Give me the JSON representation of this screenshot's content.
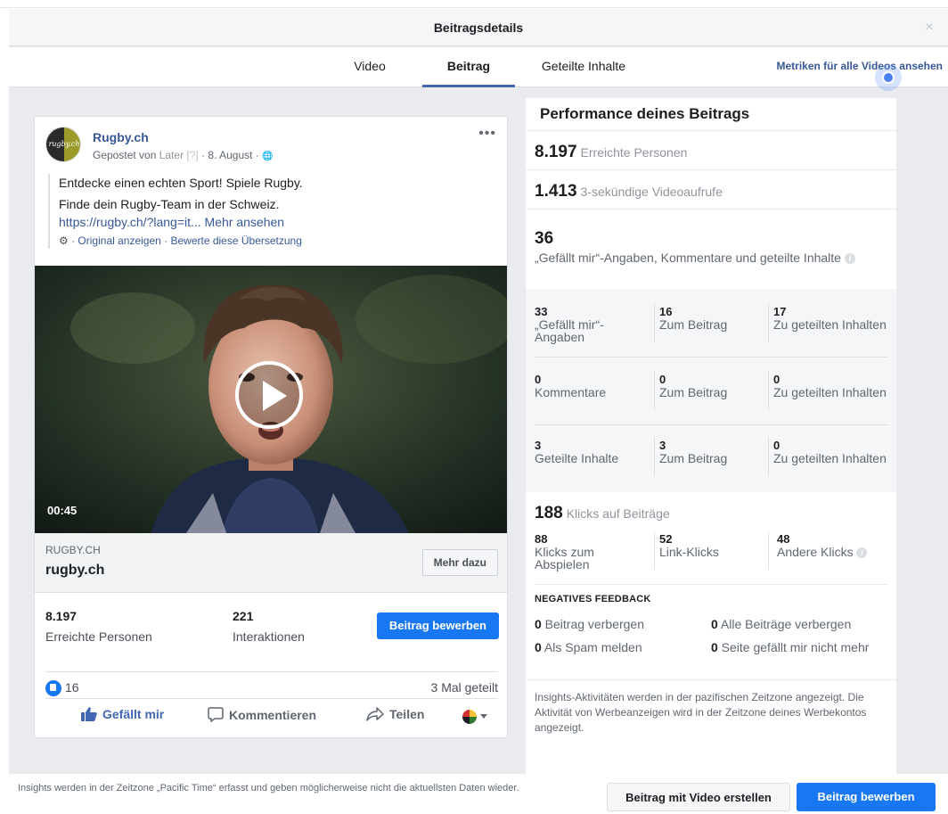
{
  "dialog": {
    "title": "Beitragsdetails",
    "close_glyph": "×"
  },
  "tabs": [
    {
      "label": "Video",
      "active": false
    },
    {
      "label": "Beitrag",
      "active": true
    },
    {
      "label": "Geteilte Inhalte",
      "active": false
    }
  ],
  "metrics_link": "Metriken für alle Videos ansehen",
  "post": {
    "page_name": "Rugby.ch",
    "avatar_text": "rugby.ch",
    "meta_prefix": "Gepostet von ",
    "meta_tool": "Later",
    "meta_q": " [?]",
    "meta_suffix": " · 8. August · ",
    "globe_glyph": "🌐",
    "more_glyph": "•••",
    "text_line1": "Entdecke einen echten Sport! Spiele Rugby.",
    "text_line2": "Finde dein Rugby-Team in der Schweiz.",
    "text_link": "https://rugby.ch/?lang=it...",
    "more_link": " Mehr ansehen",
    "translation_gear": "⚙",
    "translation_text": " · Original anzeigen · Bewerte diese Übersetzung",
    "video_duration": "00:45",
    "link_domain": "RUGBY.CH",
    "link_title": "rugby.ch",
    "link_button": "Mehr dazu",
    "reach_value": "8.197",
    "reach_label": "Erreichte Personen",
    "interactions_value": "221",
    "interactions_label": "Interaktionen",
    "boost_button": "Beitrag bewerben",
    "reactions_count": "16",
    "shares_text": "3 Mal geteilt",
    "action_like": "Gefällt mir",
    "action_comment": "Kommentieren",
    "action_share": "Teilen"
  },
  "performance": {
    "title": "Performance deines Beitrags",
    "reach_num": "8.197",
    "reach_label": "Erreichte Personen",
    "views_num": "1.413",
    "views_label": "3-sekündige Videoaufrufe",
    "interactions_num": "36",
    "interactions_label": "„Gefällt mir“-Angaben, Kommentare und geteilte Inhalte",
    "grid": [
      [
        {
          "v": "33",
          "l": "„Gefällt mir“-Angaben"
        },
        {
          "v": "16",
          "l": "Zum Beitrag"
        },
        {
          "v": "17",
          "l": "Zu geteilten Inhalten"
        }
      ],
      [
        {
          "v": "0",
          "l": "Kommentare"
        },
        {
          "v": "0",
          "l": "Zum Beitrag"
        },
        {
          "v": "0",
          "l": "Zu geteilten Inhalten"
        }
      ],
      [
        {
          "v": "3",
          "l": "Geteilte Inhalte"
        },
        {
          "v": "3",
          "l": "Zum Beitrag"
        },
        {
          "v": "0",
          "l": "Zu geteilten Inhalten"
        }
      ]
    ],
    "clicks_num": "188",
    "clicks_label": "Klicks auf Beiträge",
    "clicks": [
      {
        "v": "88",
        "l": "Klicks zum Abspielen"
      },
      {
        "v": "52",
        "l": "Link-Klicks"
      },
      {
        "v": "48",
        "l": "Andere Klicks"
      }
    ],
    "negative_title": "NEGATIVES FEEDBACK",
    "negative": [
      {
        "v": "0",
        "l": " Beitrag verbergen"
      },
      {
        "v": "0",
        "l": " Alle Beiträge verbergen"
      },
      {
        "v": "0",
        "l": " Als Spam melden"
      },
      {
        "v": "0",
        "l": " Seite gefällt mir nicht mehr"
      }
    ],
    "footnote": "Insights-Aktivitäten werden in der pazifischen Zeitzone angezeigt. Die Aktivität von Werbeanzeigen wird in der Zeitzone deines Werbekontos angezeigt.",
    "info_glyph": "i"
  },
  "footer": {
    "note": "Insights werden in der Zeitzone „Pacific Time“ erfasst und geben möglicherweise nicht die aktuellsten Daten wieder.",
    "btn_create_video": "Beitrag mit Video erstellen",
    "btn_boost": "Beitrag bewerben"
  },
  "colors": {
    "accent": "#1877f2",
    "link": "#385898",
    "tab_underline": "#4267b2"
  }
}
